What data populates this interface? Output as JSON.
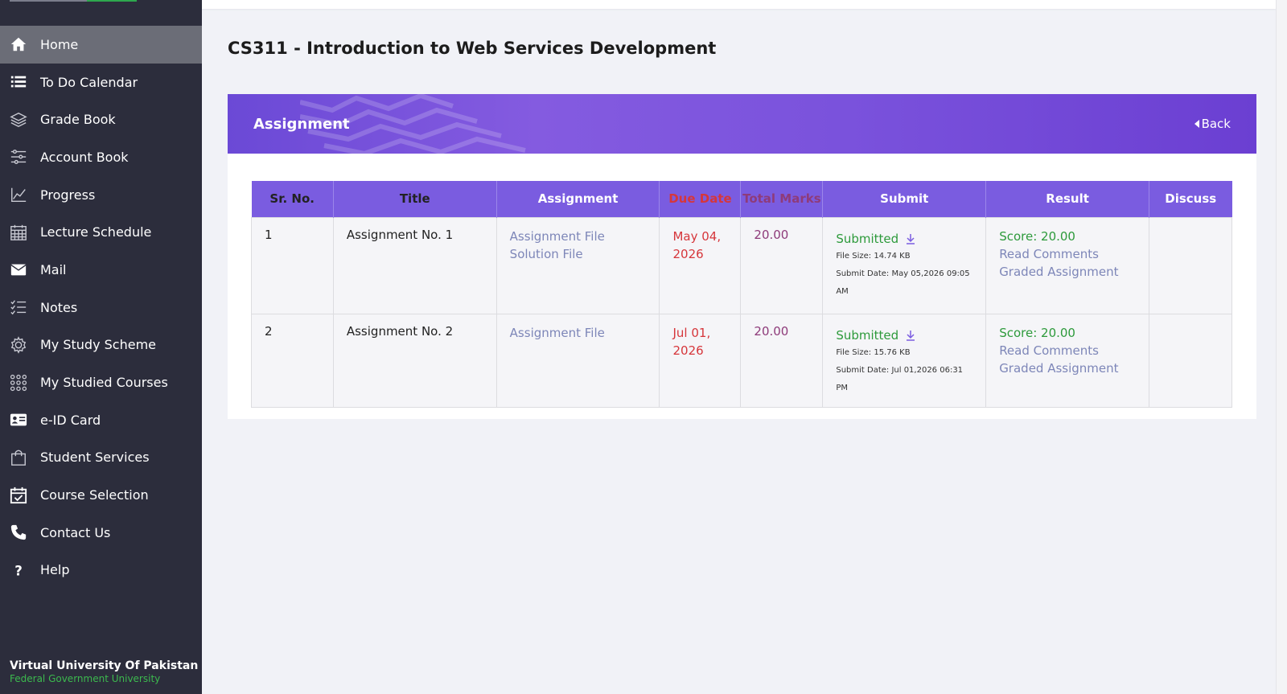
{
  "sidebar": {
    "items": [
      {
        "label": "Home",
        "icon": "home-icon"
      },
      {
        "label": "To Do Calendar",
        "icon": "list-icon"
      },
      {
        "label": "Grade Book",
        "icon": "layers-icon"
      },
      {
        "label": "Account Book",
        "icon": "sliders-icon"
      },
      {
        "label": "Progress",
        "icon": "chart-icon"
      },
      {
        "label": "Lecture Schedule",
        "icon": "calendar-grid-icon"
      },
      {
        "label": "Mail",
        "icon": "envelope-icon"
      },
      {
        "label": "Notes",
        "icon": "checklist-icon"
      },
      {
        "label": "My Study Scheme",
        "icon": "gear-icon"
      },
      {
        "label": "My Studied Courses",
        "icon": "grid-dots-icon"
      },
      {
        "label": "e-ID Card",
        "icon": "id-card-icon"
      },
      {
        "label": "Student Services",
        "icon": "bag-icon"
      },
      {
        "label": "Course Selection",
        "icon": "calendar-check-icon"
      },
      {
        "label": "Contact Us",
        "icon": "phone-icon"
      },
      {
        "label": "Help",
        "icon": "question-icon"
      }
    ],
    "active": "Home",
    "brand_name": "Virtual University Of Pakistan",
    "brand_sub": "Federal Government University"
  },
  "page": {
    "title": "CS311 - Introduction to Web Services Development"
  },
  "card": {
    "title": "Assignment",
    "back_label": "Back"
  },
  "table": {
    "headers": [
      "Sr. No.",
      "Title",
      "Assignment",
      "Due Date",
      "Total Marks",
      "Submit",
      "Result",
      "Discuss"
    ],
    "rows": [
      {
        "sr": "1",
        "title": "Assignment No. 1",
        "assignment_file": "Assignment File",
        "solution_file": "Solution File",
        "due_line1": "May 04,",
        "due_line2": "2026",
        "marks": "20.00",
        "submit_status": "Submitted",
        "file_size": "File Size: 14.74 KB",
        "submit_date": "Submit Date: May 05,2026 09:05",
        "submit_date_2": "AM",
        "score": "Score: 20.00",
        "read_comments": "Read Comments",
        "graded": "Graded Assignment"
      },
      {
        "sr": "2",
        "title": "Assignment No. 2",
        "assignment_file": "Assignment File",
        "due_line1": "Jul 01,",
        "due_line2": "2026",
        "marks": "20.00",
        "submit_status": "Submitted",
        "file_size": "File Size: 15.76 KB",
        "submit_date": "Submit Date: Jul 01,2026 06:31 PM",
        "score": "Score: 20.00",
        "read_comments": "Read Comments",
        "graded": "Graded Assignment"
      }
    ]
  },
  "colors": {
    "sidebar_bg": "#2c2d3c",
    "header_purple": "#7a5ce0",
    "submitted_green": "#2d9a3b",
    "due_red": "#d6363b",
    "link_blue": "#7d86b8"
  }
}
